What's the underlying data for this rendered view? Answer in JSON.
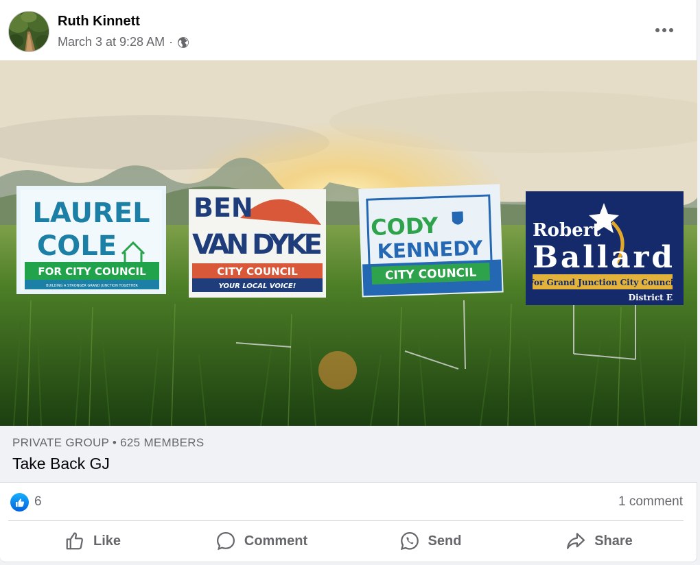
{
  "post": {
    "author": "Ruth Kinnett",
    "timestamp": "March 3 at 9:28 AM",
    "separator": "·",
    "privacy_icon": "globe-icon",
    "more_icon": "more-options-icon"
  },
  "image": {
    "signs": [
      {
        "line1": "LAUREL",
        "line2": "COLE",
        "line3": "FOR CITY COUNCIL",
        "line4": "BUILDING A STRONGER GRAND JUNCTION TOGETHER"
      },
      {
        "line1": "BEN",
        "line2": "VAN DYKE",
        "line3": "CITY COUNCIL",
        "line4": "YOUR LOCAL VOICE!"
      },
      {
        "line1": "CODY",
        "line2": "KENNEDY",
        "line3": "CITY COUNCIL"
      },
      {
        "line1": "Robert",
        "line2": "Ballard",
        "line3": "For Grand Junction City Council",
        "line4": "District E"
      }
    ]
  },
  "group": {
    "meta": "PRIVATE GROUP • 625 MEMBERS",
    "name": "Take Back GJ"
  },
  "reactions": {
    "like_count": "6",
    "comment_count": "1 comment"
  },
  "actions": {
    "like": "Like",
    "comment": "Comment",
    "send": "Send",
    "share": "Share"
  },
  "colors": {
    "secondary_text": "#65676b",
    "like_blue": "#0866ff",
    "group_bg": "#f0f2f5"
  }
}
